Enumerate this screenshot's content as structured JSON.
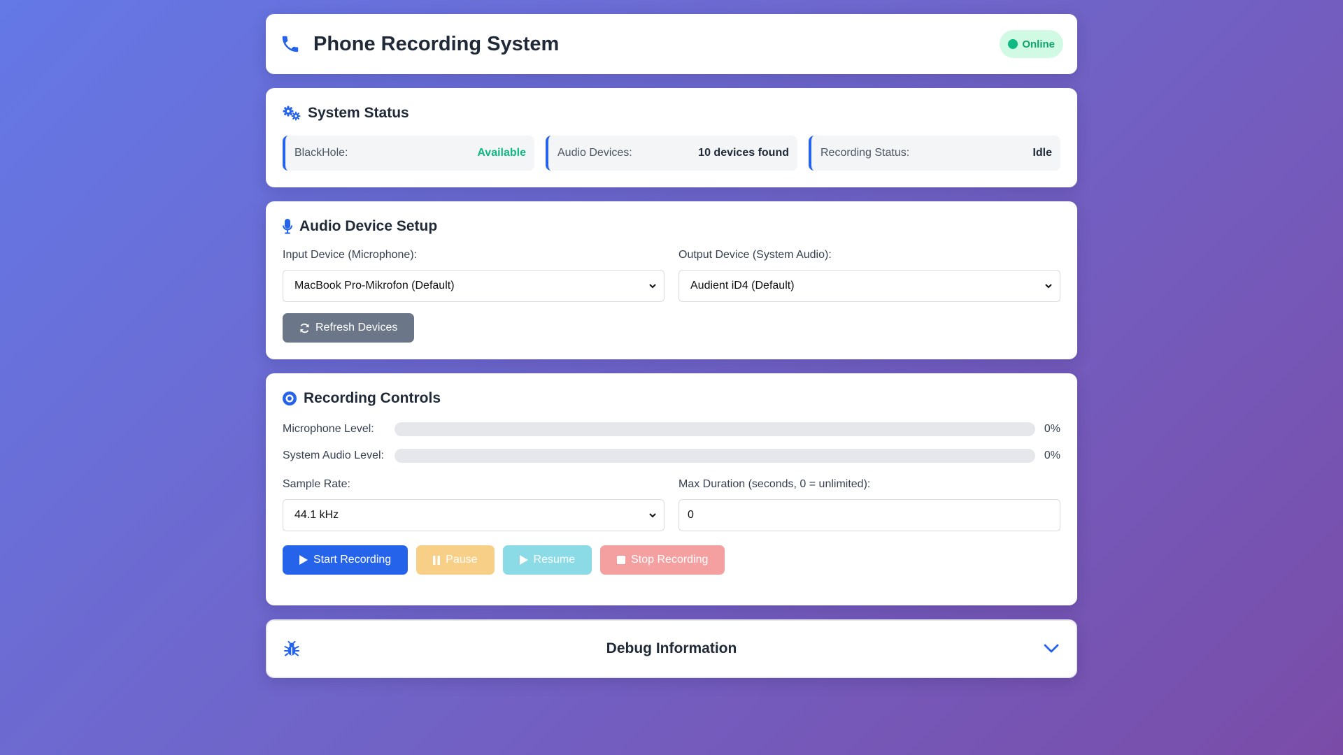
{
  "header": {
    "title": "Phone Recording System",
    "status": "Online"
  },
  "system_status": {
    "title": "System Status",
    "items": [
      {
        "label": "BlackHole:",
        "value": "Available"
      },
      {
        "label": "Audio Devices:",
        "value": "10 devices found"
      },
      {
        "label": "Recording Status:",
        "value": "Idle"
      }
    ]
  },
  "audio_setup": {
    "title": "Audio Device Setup",
    "input_label": "Input Device (Microphone):",
    "input_value": "MacBook Pro-Mikrofon (Default)",
    "output_label": "Output Device (System Audio):",
    "output_value": "Audient iD4 (Default)",
    "refresh_label": "Refresh Devices"
  },
  "recording": {
    "title": "Recording Controls",
    "mic_label": "Microphone Level:",
    "mic_level": "0%",
    "mic_level_fraction": 0,
    "sys_label": "System Audio Level:",
    "sys_level": "0%",
    "sys_level_fraction": 0,
    "sample_rate_label": "Sample Rate:",
    "sample_rate_value": "44.1 kHz",
    "max_duration_label": "Max Duration (seconds, 0 = unlimited):",
    "max_duration_value": "0",
    "buttons": {
      "start": "Start Recording",
      "pause": "Pause",
      "resume": "Resume",
      "stop": "Stop Recording"
    }
  },
  "debug": {
    "title": "Debug Information"
  },
  "colors": {
    "accent": "#2563eb",
    "success": "#10b981",
    "pause": "#f8cf87",
    "resume": "#8adbe6",
    "stop": "#f4a0a0"
  }
}
